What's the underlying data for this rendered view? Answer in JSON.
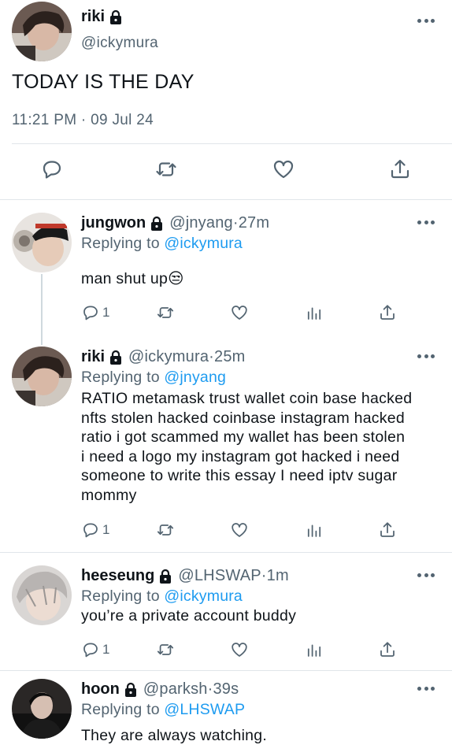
{
  "main_tweet": {
    "name": "riki",
    "handle": "@ickymura",
    "text": "TODAY IS THE DAY",
    "time": "11:21 PM",
    "separator": "·",
    "date": "09 Jul 24",
    "actions": [
      "reply-icon",
      "retweet-icon",
      "like-icon",
      "share-icon"
    ]
  },
  "replies": [
    {
      "name": "jungwon",
      "handle": "@jnyang",
      "time": "27m",
      "replying_prefix": "Replying to ",
      "replying_to": "@ickymura",
      "text": "man shut up😒",
      "reply_count": "1"
    },
    {
      "name": "riki",
      "handle": "@ickymura",
      "time": "25m",
      "replying_prefix": "Replying to ",
      "replying_to": "@jnyang",
      "text": "RATIO metamask trust wallet coin base hacked\nnfts stolen hacked coinbase instagram hacked\nratio i got scammed my wallet has been stolen\ni need a logo my instagram got hacked i need\nsomeone to write this essay I need iptv sugar\nmommy",
      "reply_count": "1"
    },
    {
      "name": "heeseung",
      "handle": "@LHSWAP",
      "time": "1m",
      "replying_prefix": "Replying to ",
      "replying_to": "@ickymura",
      "text": "you’re a private account buddy",
      "reply_count": "1"
    },
    {
      "name": "hoon",
      "handle": "@parksh",
      "time": "39s",
      "replying_prefix": "Replying to ",
      "replying_to": "@LHSWAP",
      "text": "They are always watching."
    }
  ],
  "separator": " · ",
  "icons": {
    "lock": "lock-icon",
    "more": "more-icon",
    "reply": "reply-icon",
    "retweet": "retweet-icon",
    "like": "like-icon",
    "analytics": "analytics-icon",
    "share": "share-icon"
  },
  "colors": {
    "link": "#1d9bf0",
    "secondary_text": "#536471",
    "divider": "#e1e6ea",
    "thread_line": "#cfd9de"
  }
}
